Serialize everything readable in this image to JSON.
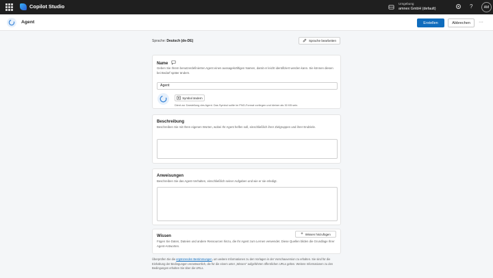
{
  "topbar": {
    "app_name": "Copilot Studio",
    "environment_label": "Umgebung",
    "environment_name": "amnex GmbH (default)",
    "user_initials": "AM",
    "icons": [
      "app-launcher-icon",
      "environment-icon",
      "settings-icon",
      "help-icon"
    ]
  },
  "header": {
    "title": "Agent",
    "create_label": "Erstellen",
    "cancel_label": "Abbrechen",
    "more_label": "···",
    "accent_color": "#0f6cbd"
  },
  "language": {
    "label": "Sprache:",
    "value": "Deutsch (de-DE)",
    "edit_label": "Sprache bearbeiten"
  },
  "name_section": {
    "title": "Name",
    "description": "Geben Sie Ihrem benutzerdefinierten Agent einen aussagekräftigen Namen, damit er leicht identifiziert werden kann. Sie können diesen bei Bedarf später ändern.",
    "value": "Agent",
    "change_symbol_label": "Symbol ändern",
    "symbol_hint": "Dient zur Darstellung des Agent. Das Symbol sollte im PNG-Format vorliegen und kleiner als 30 KB sein."
  },
  "description_section": {
    "title": "Beschreibung",
    "description": "Beschreiben Sie mit Ihren eigenen Worten, wobei Ihr Agent helfen soll, einschließlich ihrer Zielgruppen und ihrer Endziele."
  },
  "instructions_section": {
    "title": "Anweisungen",
    "description": "Beschreiben Sie das Agent-Verhalten, einschließlich seiner Aufgaben und wie er sie erledigt."
  },
  "knowledge_section": {
    "title": "Wissen",
    "add_label": "Wissen hinzufügen",
    "description": "Fügen Sie Daten, Dateien und andere Ressourcen hinzu, die Ihr Agent zum Lernen verwendet. Diese Quellen bilden die Grundlage Ihrer Agent-Antworten."
  },
  "footnote": {
    "text_before": "Überprüfen Sie die ",
    "link": "ergänzenden Bestimmungen",
    "text_after": ", um weitere Informationen zu den Vorlagen in der Vorschauversion zu erhalten. Sie sind für die Einhaltung der Bedingungen verantwortlich, die für die einem unter „Wissen\" aufgeführten öffentlichen URLs gelten. Weitere Informationen zu den Bedingungen erhalten Sie über die URLs."
  }
}
